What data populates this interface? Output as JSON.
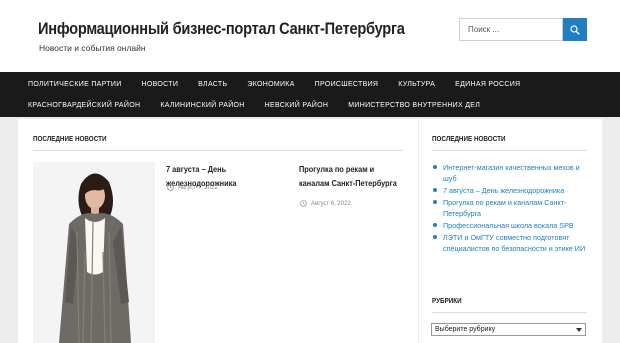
{
  "header": {
    "title": "Информационный бизнес-портал Санкт-Петербурга",
    "description": "Новости и события онлайн"
  },
  "search": {
    "placeholder": "Поиск ..."
  },
  "icons": {
    "search_button": "search-icon",
    "post_meta": "clock-icon"
  },
  "colors": {
    "accent": "#1f7fc1",
    "nav_bg": "#1a1a1a",
    "page_bg": "#ececec"
  },
  "nav": {
    "row1": [
      "Политические партии",
      "Новости",
      "Власть",
      "Экономика",
      "Происшествия",
      "Культура",
      "Единая Россия"
    ],
    "row2": [
      "Красногвардейский район",
      "Калининский район",
      "Невский район",
      "Министерство внутренних дел"
    ]
  },
  "main": {
    "section_title": "Последние новости",
    "posts": [
      {
        "title": "7 августа – День железнодорожника",
        "date": "Август 7, 2022"
      },
      {
        "title": "Прогулка по рекам и каналам Санкт-Петербурга",
        "date": "Август 6, 2022"
      }
    ]
  },
  "sidebar": {
    "recent_title": "Последние новости",
    "recent_items": [
      "Интернет-магазин качественных мехов и шуб",
      "7 августа – День железнодорожника",
      "Прогулка по рекам и каналам Санкт-Петербурга",
      "Профессиональная школа вокала SPB",
      "ЛЭТИ и ОмГТУ совместно подготовят специалистов по безопасности и этике ИИ"
    ],
    "categories_title": "Рубрики",
    "categories_select": "Выберите рубрику"
  }
}
